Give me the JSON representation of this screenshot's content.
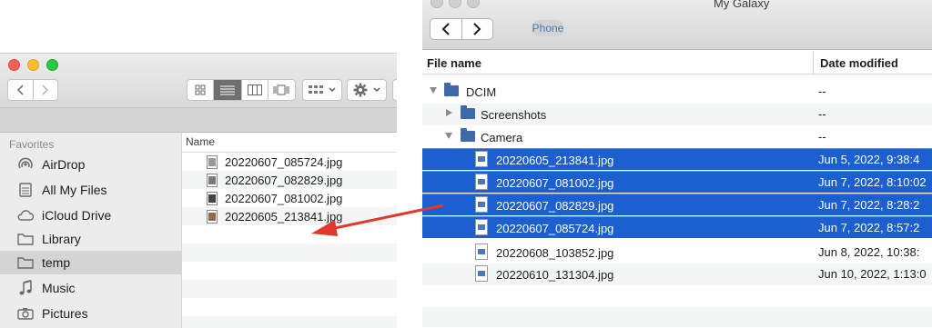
{
  "finder": {
    "sidebar": {
      "header": "Favorites",
      "items": [
        {
          "label": "AirDrop",
          "icon": "airdrop-icon"
        },
        {
          "label": "All My Files",
          "icon": "all-files-icon"
        },
        {
          "label": "iCloud Drive",
          "icon": "cloud-icon"
        },
        {
          "label": "Library",
          "icon": "folder-icon"
        },
        {
          "label": "temp",
          "icon": "folder-icon",
          "selected": true
        },
        {
          "label": "Music",
          "icon": "music-icon"
        },
        {
          "label": "Pictures",
          "icon": "camera-icon"
        }
      ]
    },
    "column_header": "Name",
    "files": [
      "20220607_085724.jpg",
      "20220607_082829.jpg",
      "20220607_081002.jpg",
      "20220605_213841.jpg"
    ]
  },
  "galaxy": {
    "title": "My Galaxy",
    "tab": "Phone",
    "columns": {
      "name": "File name",
      "date": "Date modified"
    },
    "rows": [
      {
        "name": "DCIM",
        "date": "--",
        "kind": "folder",
        "state": "expanded"
      },
      {
        "name": "Screenshots",
        "date": "--",
        "kind": "folder",
        "state": "collapsed"
      },
      {
        "name": "Camera",
        "date": "--",
        "kind": "folder",
        "state": "expanded"
      },
      {
        "name": "20220605_213841.jpg",
        "date": "Jun 5, 2022, 9:38:4",
        "kind": "file",
        "selected": true
      },
      {
        "name": "20220607_081002.jpg",
        "date": "Jun 7, 2022, 8:10:02",
        "kind": "file",
        "selected": true
      },
      {
        "name": "20220607_082829.jpg",
        "date": "Jun 7, 2022, 8:28:2",
        "kind": "file",
        "selected": true
      },
      {
        "name": "20220607_085724.jpg",
        "date": "Jun 7, 2022, 8:57:2",
        "kind": "file",
        "selected": true
      },
      {
        "name": "20220608_103852.jpg",
        "date": "Jun 8, 2022, 10:38:",
        "kind": "file",
        "selected": false
      },
      {
        "name": "20220610_131304.jpg",
        "date": "Jun 10, 2022, 1:13:0",
        "kind": "file",
        "selected": false
      }
    ]
  },
  "colors": {
    "selection": "#1c5fd0",
    "arrow": "#e0392b",
    "folder": "#3d6aa6"
  }
}
